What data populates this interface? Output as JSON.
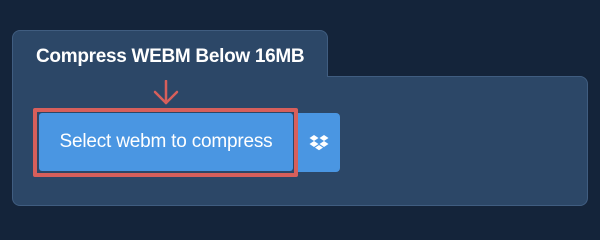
{
  "panel": {
    "title": "Compress WEBM Below 16MB"
  },
  "upload": {
    "select_label": "Select webm to compress",
    "dropbox_icon": "dropbox-icon",
    "pointer_icon": "down-arrow-icon"
  },
  "colors": {
    "page_background": "#14243a",
    "panel_background": "#2c4767",
    "button": "#4a96e2",
    "highlight": "#d75f5b"
  }
}
